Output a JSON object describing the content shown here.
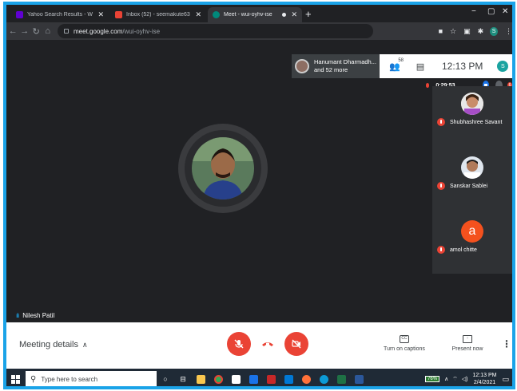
{
  "browser": {
    "tabs": [
      {
        "title": "Yahoo Search Results - Web sea",
        "favicon_color": "#6001d2",
        "active": false
      },
      {
        "title": "Inbox (52) - seemakute63@gma",
        "favicon_color": "#ea4335",
        "active": false
      },
      {
        "title": "Meet - wui-oyhv-ise",
        "favicon_color": "#00897b",
        "active": true
      }
    ],
    "url_host": "meet.google.com",
    "url_path": "/wui-oyhv-ise",
    "profile_initial": "S"
  },
  "meet": {
    "presenter_name": "Hanumant Dharmadh...",
    "presenter_more": "and 52 more",
    "participant_count": "58",
    "clock": "12:13 PM",
    "profile_initial": "S",
    "recording_time": "0:29:53",
    "notification_count": "6",
    "participants": [
      {
        "name": "Shubhashree Savant",
        "muted": true
      },
      {
        "name": "Sanskar Sablei",
        "muted": true
      },
      {
        "name": "amol chitte",
        "muted": true,
        "initial": "a"
      }
    ],
    "speaker_name": "Nilesh Patil"
  },
  "controls": {
    "meeting_details": "Meeting details",
    "captions_label": "Turn on captions",
    "captions_icon_text": "CC",
    "present_label": "Present now"
  },
  "taskbar": {
    "search_placeholder": "Type here to search",
    "battery": "76%",
    "time": "12:13 PM",
    "date": "2/4/2021"
  },
  "colors": {
    "accent": "#1aa3e8",
    "red": "#ea4335",
    "meet_bg": "#202124",
    "avatar_orange": "#f4511e"
  }
}
